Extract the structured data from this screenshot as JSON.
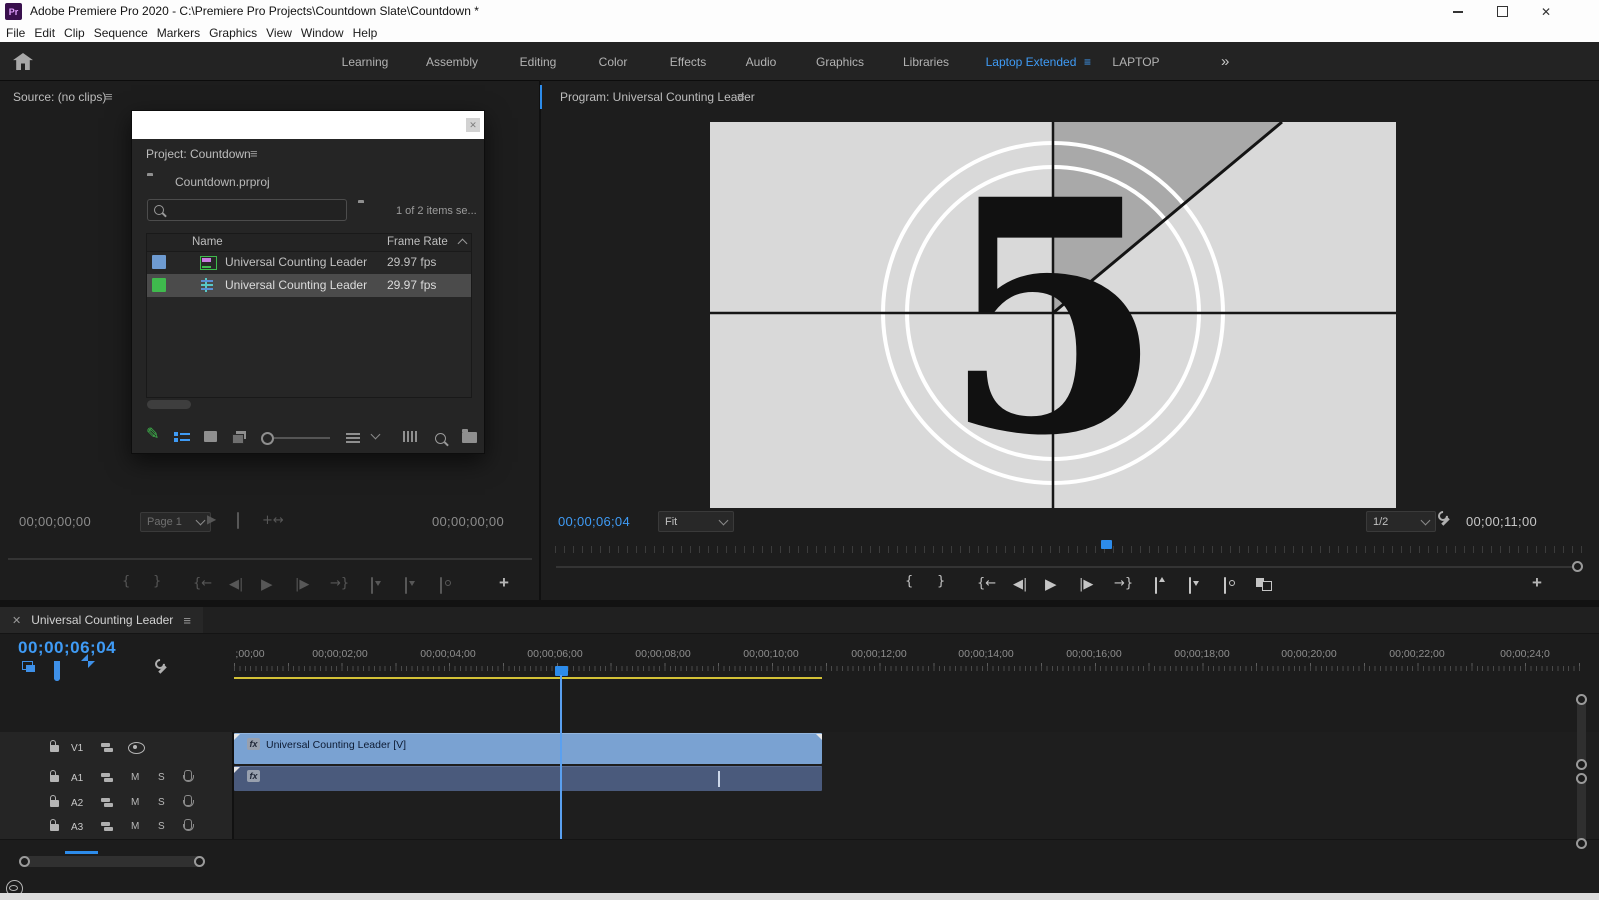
{
  "colors": {
    "accent_blue": "#3f9bf5",
    "playhead_blue": "#2d8ceb",
    "workspace_bg": "#232323",
    "panel_bg": "#1d1d1d",
    "video_clip": "#7aa2d2",
    "audio_clip": "#4a5a7c",
    "work_area_yellow": "#d3c136",
    "slate_bg": "#d9d9d9",
    "slate_wedge": "#a9a9a9",
    "label_blue": "#6e9bd1",
    "label_green": "#3fba4d"
  },
  "titlebar": {
    "app_initials": "Pr",
    "title": "Adobe Premiere Pro 2020 - C:\\Premiere Pro Projects\\Countdown Slate\\Countdown *"
  },
  "menu": {
    "items": [
      "File",
      "Edit",
      "Clip",
      "Sequence",
      "Markers",
      "Graphics",
      "View",
      "Window",
      "Help"
    ]
  },
  "workspaces": {
    "items": [
      "Learning",
      "Assembly",
      "Editing",
      "Color",
      "Effects",
      "Audio",
      "Graphics",
      "Libraries",
      "Laptop Extended",
      "LAPTOP"
    ],
    "active": "Laptop Extended",
    "overflow": "»"
  },
  "source": {
    "title": "Source: (no clips)",
    "tc_left": "00;00;00;00",
    "tc_right": "00;00;00;00",
    "page_selector": "Page 1"
  },
  "project": {
    "panel_title": "Project: Countdown",
    "bin_name": "Countdown.prproj",
    "status": "1 of 2 items se...",
    "columns": {
      "name": "Name",
      "rate": "Frame Rate"
    },
    "rows": [
      {
        "kind": "clip",
        "label_color": "#6e9bd1",
        "name": "Universal Counting Leader",
        "rate": "29.97 fps",
        "selected": false
      },
      {
        "kind": "sequence",
        "label_color": "#3fba4d",
        "name": "Universal Counting Leader",
        "rate": "29.97 fps",
        "selected": true
      }
    ]
  },
  "program": {
    "title": "Program: Universal Counting Leader",
    "tc": "00;00;06;04",
    "zoom_level": "Fit",
    "playback_resolution": "1/2",
    "duration": "00;00;11;00",
    "slate_number": "5"
  },
  "timeline": {
    "tab": "Universal Counting Leader",
    "tc": "00;00;06;04",
    "ruler": [
      ";00;00",
      "00;00;02;00",
      "00;00;04;00",
      "00;00;06;00",
      "00;00;08;00",
      "00;00;10;00",
      "00;00;12;00",
      "00;00;14;00",
      "00;00;16;00",
      "00;00;18;00",
      "00;00;20;00",
      "00;00;22;00",
      "00;00;24;0"
    ],
    "tracks": [
      {
        "id": "V1"
      },
      {
        "id": "A1"
      },
      {
        "id": "A2"
      },
      {
        "id": "A3"
      }
    ],
    "mute": "M",
    "solo": "S",
    "fx_badge": "fx",
    "video_clip_name": "Universal Counting Leader [V]"
  }
}
